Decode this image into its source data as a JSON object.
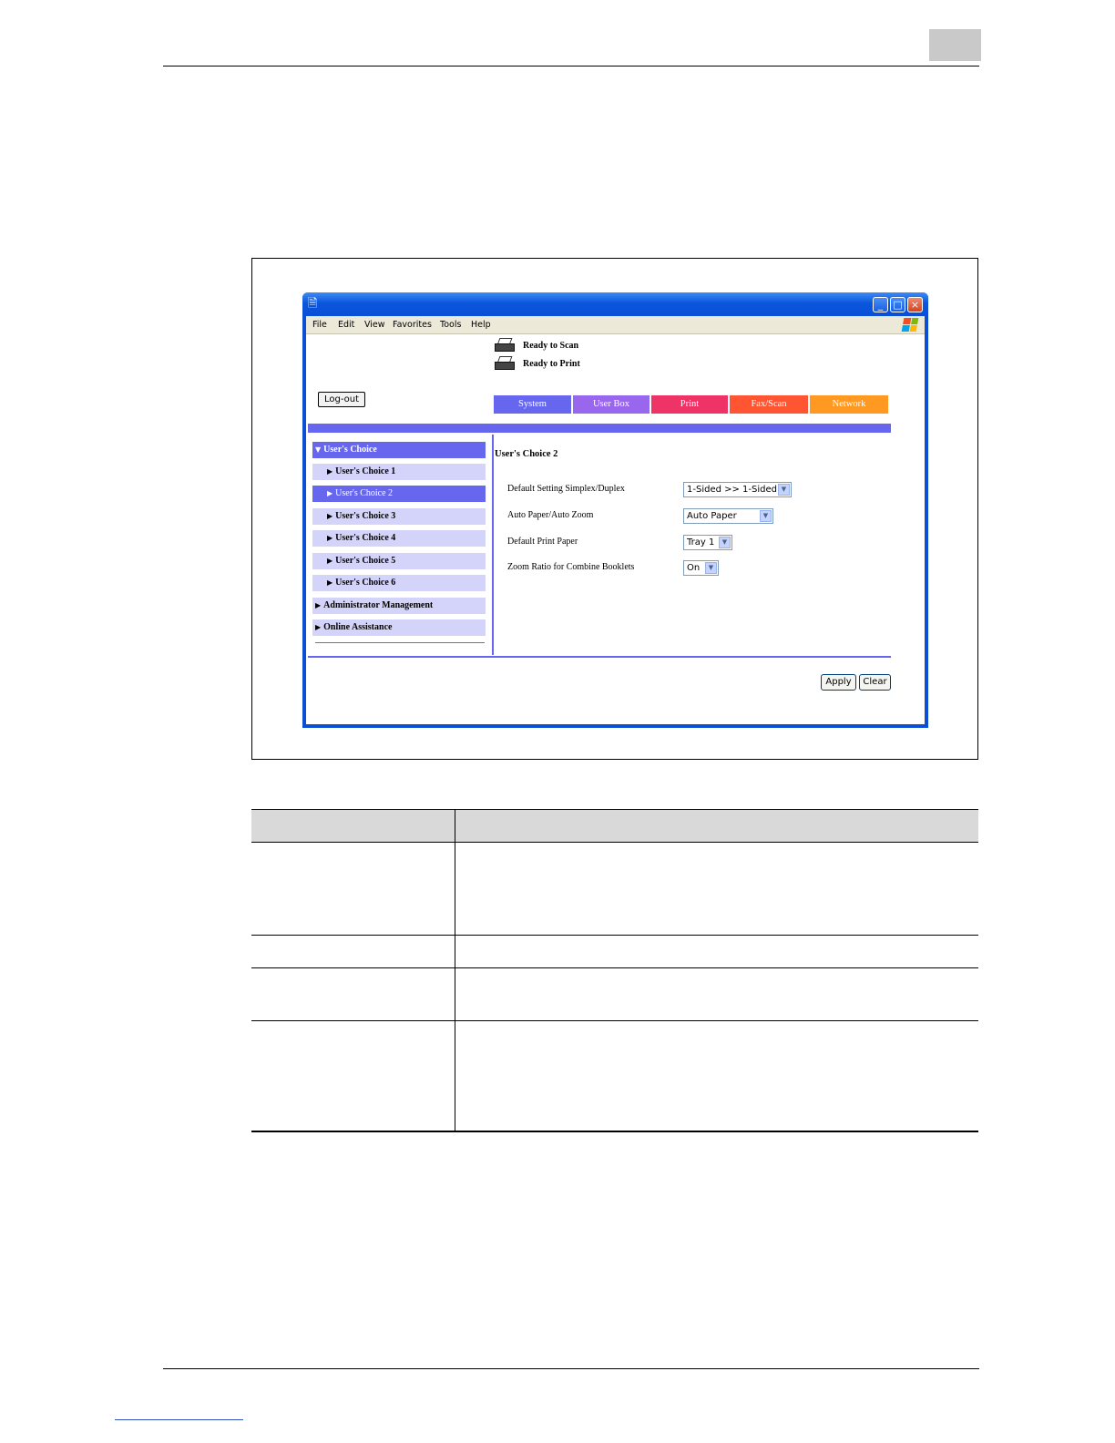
{
  "browser": {
    "menu": [
      "File",
      "Edit",
      "View",
      "Favorites",
      "Tools",
      "Help"
    ],
    "window_buttons": [
      "_",
      "□",
      "×"
    ]
  },
  "status": {
    "scan": "Ready to Scan",
    "print": "Ready to Print"
  },
  "logout_label": "Log-out",
  "tabs": [
    {
      "label": "System",
      "color": "#6666ee"
    },
    {
      "label": "User Box",
      "color": "#9966ee"
    },
    {
      "label": "Print",
      "color": "#ee3366"
    },
    {
      "label": "Fax/Scan",
      "color": "#ff5533"
    },
    {
      "label": "Network",
      "color": "#ff9922"
    }
  ],
  "sidebar": {
    "header": "User's Choice",
    "items": [
      "User's Choice 1",
      "User's Choice 2",
      "User's Choice 3",
      "User's Choice 4",
      "User's Choice 5",
      "User's Choice 6"
    ],
    "active_index": 1,
    "admin": "Administrator Management",
    "online": "Online Assistance"
  },
  "form": {
    "title": "User's Choice 2",
    "fields": [
      {
        "label": "Default Setting Simplex/Duplex",
        "value": "1-Sided >> 1-Sided"
      },
      {
        "label": "Auto Paper/Auto Zoom",
        "value": "Auto Paper"
      },
      {
        "label": "Default Print Paper",
        "value": "Tray 1"
      },
      {
        "label": "Zoom Ratio for Combine Booklets",
        "value": "On"
      }
    ],
    "apply_label": "Apply",
    "clear_label": "Clear"
  }
}
